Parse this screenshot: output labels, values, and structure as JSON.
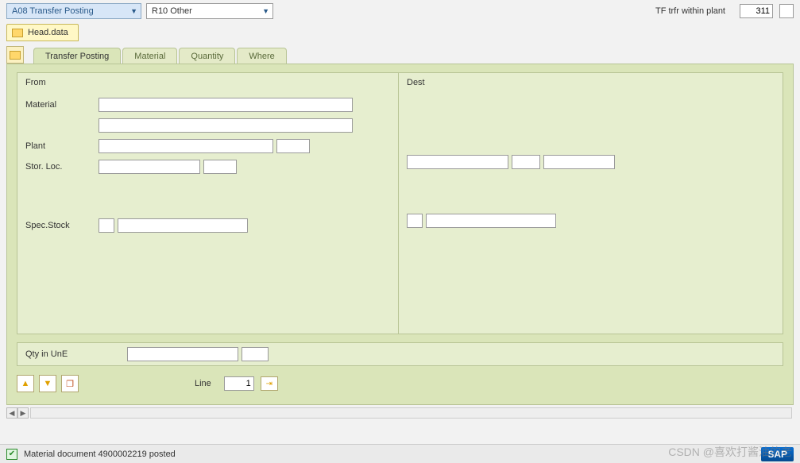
{
  "top": {
    "dropdown1": "A08 Transfer Posting",
    "dropdown2": "R10 Other",
    "tf_label": "TF trfr within plant",
    "tf_value": "311"
  },
  "folder": {
    "head_label": "Head.data"
  },
  "tabs": {
    "t1": "Transfer Posting",
    "t2": "Material",
    "t3": "Quantity",
    "t4": "Where"
  },
  "panel": {
    "from_header": "From",
    "dest_header": "Dest",
    "material_label": "Material",
    "plant_label": "Plant",
    "storloc_label": "Stor. Loc.",
    "specstock_label": "Spec.Stock"
  },
  "qty": {
    "label": "Qty in UnE"
  },
  "line": {
    "label": "Line",
    "value": "1"
  },
  "status": {
    "message": "Material document 4900002219 posted"
  },
  "watermark": "CSDN @喜欢打酱油的老",
  "logo": "SAP"
}
